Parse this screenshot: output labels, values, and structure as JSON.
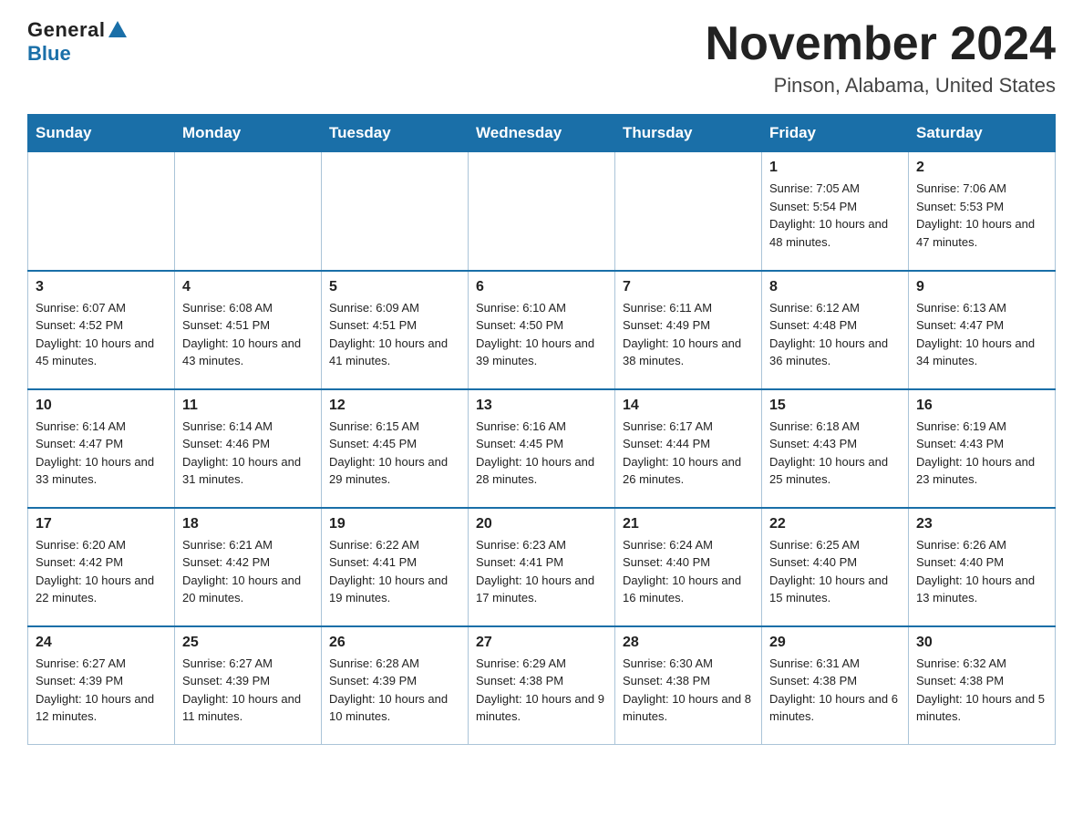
{
  "logo": {
    "general": "General",
    "blue": "Blue"
  },
  "title": "November 2024",
  "location": "Pinson, Alabama, United States",
  "days_of_week": [
    "Sunday",
    "Monday",
    "Tuesday",
    "Wednesday",
    "Thursday",
    "Friday",
    "Saturday"
  ],
  "weeks": [
    [
      {
        "day": "",
        "info": ""
      },
      {
        "day": "",
        "info": ""
      },
      {
        "day": "",
        "info": ""
      },
      {
        "day": "",
        "info": ""
      },
      {
        "day": "",
        "info": ""
      },
      {
        "day": "1",
        "info": "Sunrise: 7:05 AM\nSunset: 5:54 PM\nDaylight: 10 hours and 48 minutes."
      },
      {
        "day": "2",
        "info": "Sunrise: 7:06 AM\nSunset: 5:53 PM\nDaylight: 10 hours and 47 minutes."
      }
    ],
    [
      {
        "day": "3",
        "info": "Sunrise: 6:07 AM\nSunset: 4:52 PM\nDaylight: 10 hours and 45 minutes."
      },
      {
        "day": "4",
        "info": "Sunrise: 6:08 AM\nSunset: 4:51 PM\nDaylight: 10 hours and 43 minutes."
      },
      {
        "day": "5",
        "info": "Sunrise: 6:09 AM\nSunset: 4:51 PM\nDaylight: 10 hours and 41 minutes."
      },
      {
        "day": "6",
        "info": "Sunrise: 6:10 AM\nSunset: 4:50 PM\nDaylight: 10 hours and 39 minutes."
      },
      {
        "day": "7",
        "info": "Sunrise: 6:11 AM\nSunset: 4:49 PM\nDaylight: 10 hours and 38 minutes."
      },
      {
        "day": "8",
        "info": "Sunrise: 6:12 AM\nSunset: 4:48 PM\nDaylight: 10 hours and 36 minutes."
      },
      {
        "day": "9",
        "info": "Sunrise: 6:13 AM\nSunset: 4:47 PM\nDaylight: 10 hours and 34 minutes."
      }
    ],
    [
      {
        "day": "10",
        "info": "Sunrise: 6:14 AM\nSunset: 4:47 PM\nDaylight: 10 hours and 33 minutes."
      },
      {
        "day": "11",
        "info": "Sunrise: 6:14 AM\nSunset: 4:46 PM\nDaylight: 10 hours and 31 minutes."
      },
      {
        "day": "12",
        "info": "Sunrise: 6:15 AM\nSunset: 4:45 PM\nDaylight: 10 hours and 29 minutes."
      },
      {
        "day": "13",
        "info": "Sunrise: 6:16 AM\nSunset: 4:45 PM\nDaylight: 10 hours and 28 minutes."
      },
      {
        "day": "14",
        "info": "Sunrise: 6:17 AM\nSunset: 4:44 PM\nDaylight: 10 hours and 26 minutes."
      },
      {
        "day": "15",
        "info": "Sunrise: 6:18 AM\nSunset: 4:43 PM\nDaylight: 10 hours and 25 minutes."
      },
      {
        "day": "16",
        "info": "Sunrise: 6:19 AM\nSunset: 4:43 PM\nDaylight: 10 hours and 23 minutes."
      }
    ],
    [
      {
        "day": "17",
        "info": "Sunrise: 6:20 AM\nSunset: 4:42 PM\nDaylight: 10 hours and 22 minutes."
      },
      {
        "day": "18",
        "info": "Sunrise: 6:21 AM\nSunset: 4:42 PM\nDaylight: 10 hours and 20 minutes."
      },
      {
        "day": "19",
        "info": "Sunrise: 6:22 AM\nSunset: 4:41 PM\nDaylight: 10 hours and 19 minutes."
      },
      {
        "day": "20",
        "info": "Sunrise: 6:23 AM\nSunset: 4:41 PM\nDaylight: 10 hours and 17 minutes."
      },
      {
        "day": "21",
        "info": "Sunrise: 6:24 AM\nSunset: 4:40 PM\nDaylight: 10 hours and 16 minutes."
      },
      {
        "day": "22",
        "info": "Sunrise: 6:25 AM\nSunset: 4:40 PM\nDaylight: 10 hours and 15 minutes."
      },
      {
        "day": "23",
        "info": "Sunrise: 6:26 AM\nSunset: 4:40 PM\nDaylight: 10 hours and 13 minutes."
      }
    ],
    [
      {
        "day": "24",
        "info": "Sunrise: 6:27 AM\nSunset: 4:39 PM\nDaylight: 10 hours and 12 minutes."
      },
      {
        "day": "25",
        "info": "Sunrise: 6:27 AM\nSunset: 4:39 PM\nDaylight: 10 hours and 11 minutes."
      },
      {
        "day": "26",
        "info": "Sunrise: 6:28 AM\nSunset: 4:39 PM\nDaylight: 10 hours and 10 minutes."
      },
      {
        "day": "27",
        "info": "Sunrise: 6:29 AM\nSunset: 4:38 PM\nDaylight: 10 hours and 9 minutes."
      },
      {
        "day": "28",
        "info": "Sunrise: 6:30 AM\nSunset: 4:38 PM\nDaylight: 10 hours and 8 minutes."
      },
      {
        "day": "29",
        "info": "Sunrise: 6:31 AM\nSunset: 4:38 PM\nDaylight: 10 hours and 6 minutes."
      },
      {
        "day": "30",
        "info": "Sunrise: 6:32 AM\nSunset: 4:38 PM\nDaylight: 10 hours and 5 minutes."
      }
    ]
  ]
}
